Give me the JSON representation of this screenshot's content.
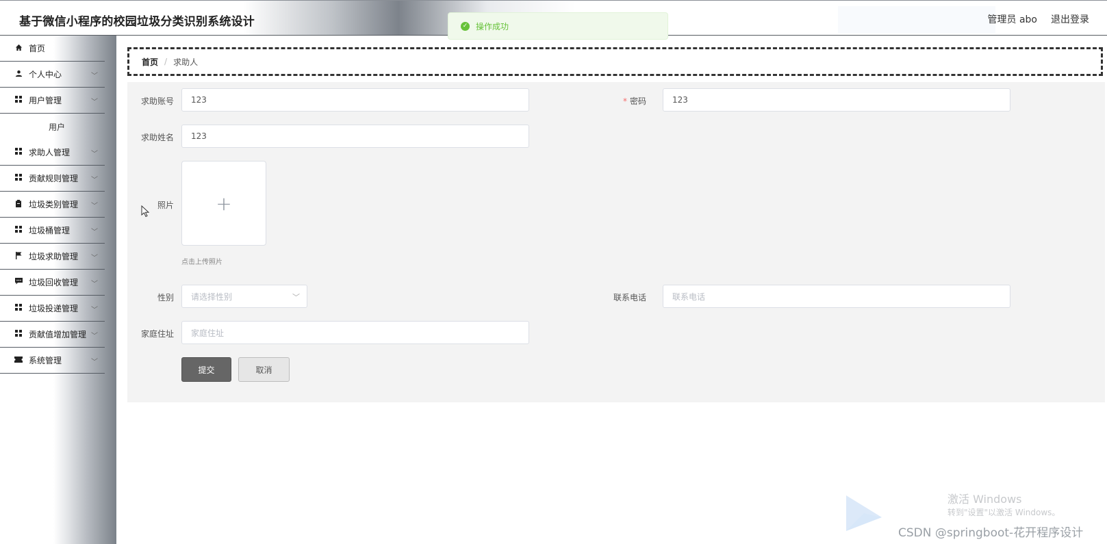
{
  "header": {
    "title": "基于微信小程序的校园垃圾分类识别系统设计",
    "user_label": "管理员 abo",
    "logout_label": "退出登录"
  },
  "toast": {
    "message": "操作成功",
    "icon": "check-circle-icon",
    "color": "#67c23a"
  },
  "sidebar": {
    "items": [
      {
        "label": "首页",
        "icon": "home-icon"
      },
      {
        "label": "个人中心",
        "icon": "user-icon"
      },
      {
        "label": "用户管理",
        "icon": "grid-icon"
      },
      {
        "label": "用户",
        "icon": ""
      },
      {
        "label": "求助人管理",
        "icon": "grid-icon"
      },
      {
        "label": "贡献规则管理",
        "icon": "grid-icon"
      },
      {
        "label": "垃圾类别管理",
        "icon": "clipboard-icon"
      },
      {
        "label": "垃圾桶管理",
        "icon": "grid-icon"
      },
      {
        "label": "垃圾求助管理",
        "icon": "flag-icon"
      },
      {
        "label": "垃圾回收管理",
        "icon": "chat-icon"
      },
      {
        "label": "垃圾投递管理",
        "icon": "grid-icon"
      },
      {
        "label": "贡献值增加管理",
        "icon": "grid-icon"
      },
      {
        "label": "系统管理",
        "icon": "ticket-icon"
      }
    ]
  },
  "breadcrumb": {
    "home": "首页",
    "separator": "/",
    "current": "求助人"
  },
  "form": {
    "account_label": "求助账号",
    "account_value": "123",
    "password_label": "密码",
    "password_required": "*",
    "password_value": "123",
    "name_label": "求助姓名",
    "name_value": "123",
    "photo_label": "照片",
    "photo_hint": "点击上传照片",
    "gender_label": "性别",
    "gender_placeholder": "请选择性别",
    "phone_label": "联系电话",
    "phone_placeholder": "联系电话",
    "address_label": "家庭住址",
    "address_placeholder": "家庭住址",
    "submit_label": "提交",
    "cancel_label": "取消"
  },
  "watermark": {
    "windows_line1": "激活 Windows",
    "windows_line2": "转到\"设置\"以激活 Windows。",
    "csdn": "CSDN @springboot-花开程序设计"
  }
}
